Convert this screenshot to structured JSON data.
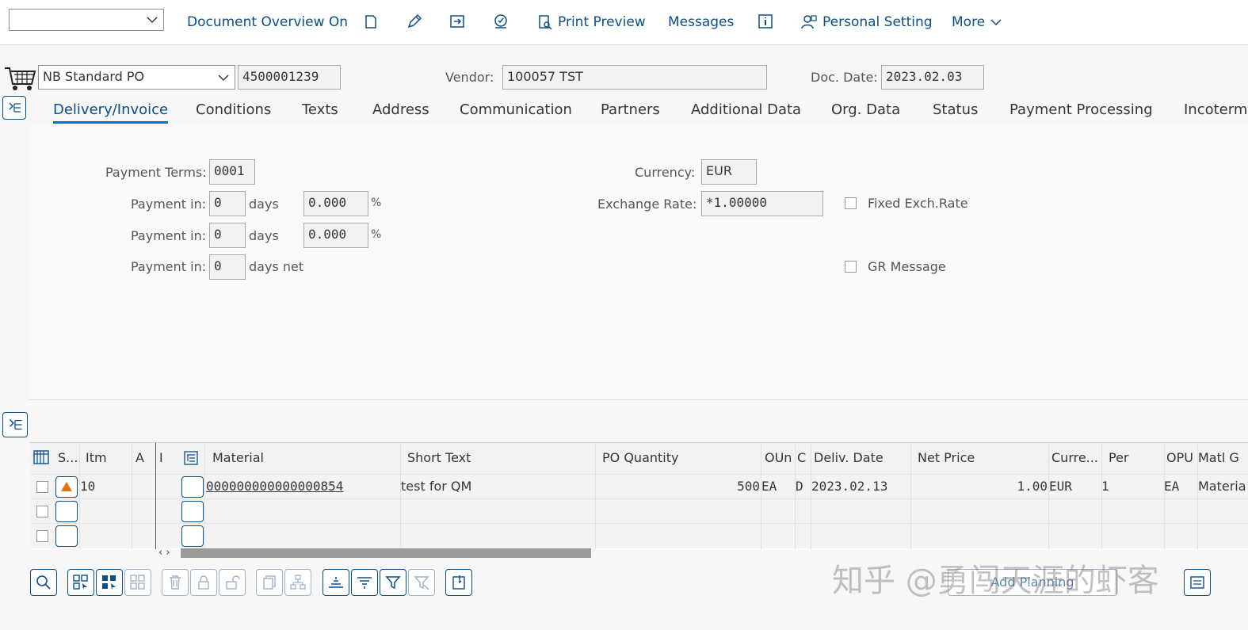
{
  "toolbar": {
    "dropdown_value": "",
    "doc_overview": "Document Overview On",
    "print_preview": "Print Preview",
    "messages": "Messages",
    "personal_setting": "Personal Setting",
    "more": "More"
  },
  "header": {
    "po_type": "NB Standard PO",
    "po_number": "4500001239",
    "vendor_label": "Vendor:",
    "vendor_value": "100057 TST",
    "doc_date_label": "Doc. Date:",
    "doc_date_value": "2023.02.03"
  },
  "tabs": [
    "Delivery/Invoice",
    "Conditions",
    "Texts",
    "Address",
    "Communication",
    "Partners",
    "Additional Data",
    "Org. Data",
    "Status",
    "Payment Processing",
    "Incoterm"
  ],
  "delivery": {
    "payment_terms_label": "Payment Terms:",
    "payment_terms_value": "0001",
    "payment_in_label": "Payment in:",
    "row1_days": "0",
    "days_label": "days",
    "row1_pct": "0.000",
    "pct": "%",
    "row2_days": "0",
    "row2_pct": "0.000",
    "row3_days": "0",
    "days_net_label": "days net",
    "currency_label": "Currency:",
    "currency_value": "EUR",
    "exchange_rate_label": "Exchange Rate:",
    "exchange_rate_value": "*1.00000",
    "fixed_exch_label": "Fixed Exch.Rate",
    "gr_message_label": "GR Message"
  },
  "items_table": {
    "columns": [
      "S...",
      "Itm",
      "A",
      "I",
      "Material",
      "Short Text",
      "PO Quantity",
      "OUn",
      "C",
      "Deliv. Date",
      "Net Price",
      "Curre...",
      "Per",
      "OPU",
      "Matl G"
    ],
    "rows": [
      {
        "itm": "10",
        "a": "",
        "i": "",
        "material": "000000000000000854",
        "short_text": "test for QM",
        "po_qty": "500",
        "oun": "EA",
        "c": "D",
        "deliv_date": "2023.02.13",
        "net_price": "1.00",
        "currency": "EUR",
        "per": "1",
        "opu": "EA",
        "matl_group": "Materia"
      }
    ]
  },
  "bottom": {
    "add_planning": "Add Planning"
  },
  "watermark": "知乎 @勇闯天涯的虾客"
}
